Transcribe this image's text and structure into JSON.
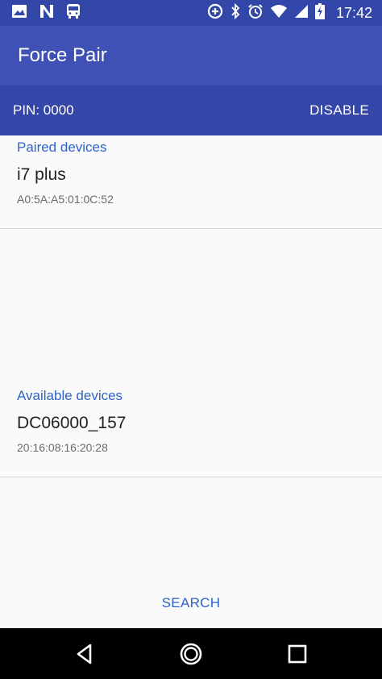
{
  "status_bar": {
    "time": "17:42",
    "left_icons": [
      "image-icon",
      "n-icon",
      "bus-icon"
    ],
    "right_icons": [
      "data-saver-icon",
      "bluetooth-icon",
      "alarm-icon",
      "wifi-icon",
      "signal-icon",
      "battery-charging-icon"
    ]
  },
  "app": {
    "title": "Force Pair",
    "primary_color": "#3f51b5",
    "accent_color": "#2e63c7"
  },
  "pin_bar": {
    "pin_label": "PIN: 0000",
    "disable_label": "DISABLE"
  },
  "paired": {
    "header": "Paired devices",
    "devices": [
      {
        "name": "i7 plus",
        "mac": "A0:5A:A5:01:0C:52"
      }
    ]
  },
  "available": {
    "header": "Available devices",
    "devices": [
      {
        "name": "DC06000_157",
        "mac": "20:16:08:16:20:28"
      }
    ]
  },
  "search_label": "SEARCH",
  "nav": {
    "icons": [
      "back-icon",
      "home-icon",
      "recents-icon"
    ]
  }
}
